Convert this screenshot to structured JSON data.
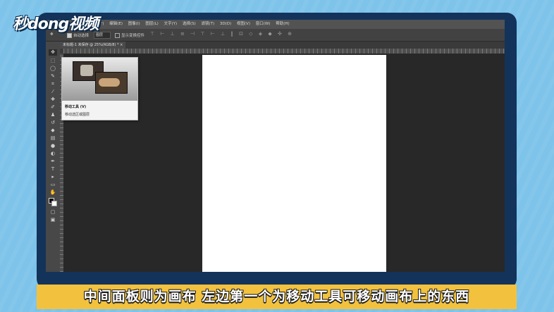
{
  "watermark": {
    "text": "秒dong视频"
  },
  "app": {
    "logo": "Ps"
  },
  "menubar": {
    "items": [
      "文件(F)",
      "编辑(E)",
      "图像(I)",
      "图层(L)",
      "文字(Y)",
      "选择(S)",
      "滤镜(T)",
      "3D(D)",
      "视图(V)",
      "窗口(W)",
      "帮助(H)"
    ]
  },
  "options": {
    "auto_select_label": "自动选择",
    "auto_select_checked": true,
    "auto_select_target": "图层",
    "show_transform_label": "显示变换控件",
    "show_transform_checked": false,
    "align_icons": "⊤ ⊢ ⊥ ≡ ⊣ ⊤ ⊢ ⊥ ‖ ⊡ ◇ ◈ ◆ ✣ ⊕"
  },
  "document_tab": {
    "title": "未标题-1 未保存 @ 25%(RGB/8) * ×"
  },
  "tooltip": {
    "title": "移动工具 (V)",
    "description": "移动选区或图层"
  },
  "subtitle": {
    "text": "中间面板则为画布 左边第一个为移动工具可移动画布上的东西"
  },
  "colors": {
    "foreground": "#000000",
    "background": "#ffffff",
    "subtitle_bg": "#f2c23e"
  }
}
